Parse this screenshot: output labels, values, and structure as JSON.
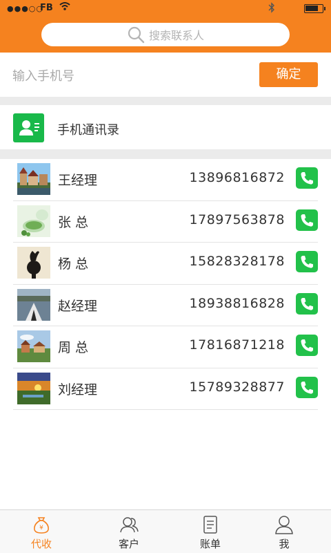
{
  "status_bar": {
    "signal": "●●●○○",
    "carrier": "FB",
    "battery_level": 0.8
  },
  "search": {
    "placeholder": "搜索联系人"
  },
  "phone_input": {
    "placeholder": "输入手机号",
    "confirm_label": "确定"
  },
  "phonebook": {
    "label": "手机通讯录"
  },
  "contacts": [
    {
      "name": "王经理",
      "phone": "13896816872",
      "photo": "town-photo"
    },
    {
      "name": "张 总",
      "phone": "17897563878",
      "photo": "tea-photo"
    },
    {
      "name": "杨 总",
      "phone": "15828328178",
      "photo": "sculpture-photo"
    },
    {
      "name": "赵经理",
      "phone": "18938816828",
      "photo": "kayak-photo"
    },
    {
      "name": "周 总",
      "phone": "17816871218",
      "photo": "village-photo"
    },
    {
      "name": "刘经理",
      "phone": "15789328877",
      "photo": "sunset-photo"
    }
  ],
  "tabs": [
    {
      "label": "代收",
      "icon": "money-bag-icon",
      "active": true
    },
    {
      "label": "客户",
      "icon": "customers-icon",
      "active": false
    },
    {
      "label": "账单",
      "icon": "bill-icon",
      "active": false
    },
    {
      "label": "我",
      "icon": "user-icon",
      "active": false
    }
  ],
  "colors": {
    "accent": "#f5821f",
    "call_green": "#22c14a",
    "phonebook_green": "#19b94a"
  }
}
